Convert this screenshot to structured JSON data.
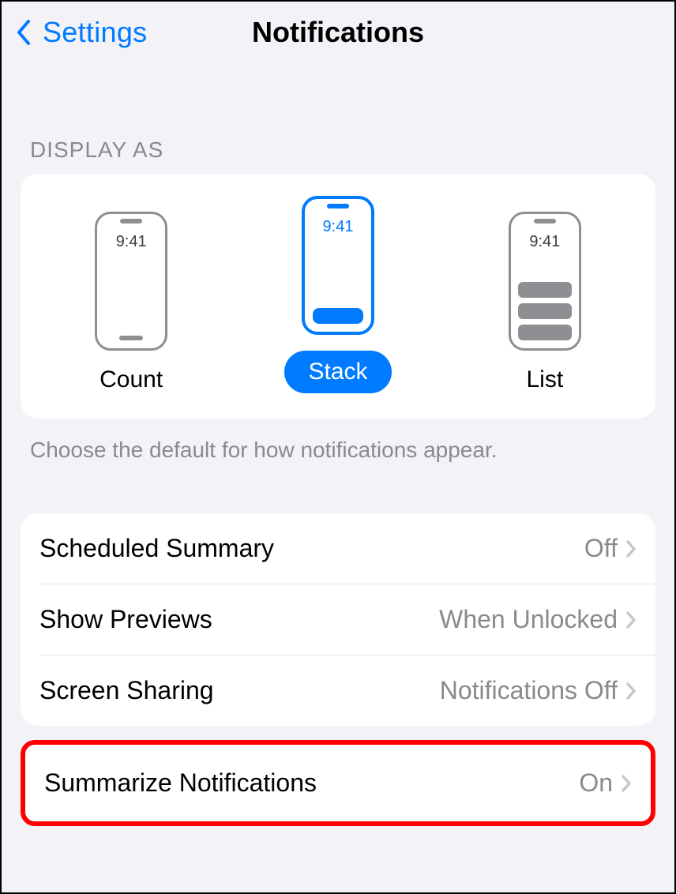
{
  "nav": {
    "back_label": "Settings",
    "title": "Notifications"
  },
  "display_as": {
    "header": "DISPLAY AS",
    "time_text": "9:41",
    "options": [
      {
        "label": "Count",
        "selected": false
      },
      {
        "label": "Stack",
        "selected": true
      },
      {
        "label": "List",
        "selected": false
      }
    ],
    "footer": "Choose the default for how notifications appear."
  },
  "rows": [
    {
      "label": "Scheduled Summary",
      "value": "Off"
    },
    {
      "label": "Show Previews",
      "value": "When Unlocked"
    },
    {
      "label": "Screen Sharing",
      "value": "Notifications Off"
    }
  ],
  "highlighted_row": {
    "label": "Summarize Notifications",
    "value": "On"
  }
}
